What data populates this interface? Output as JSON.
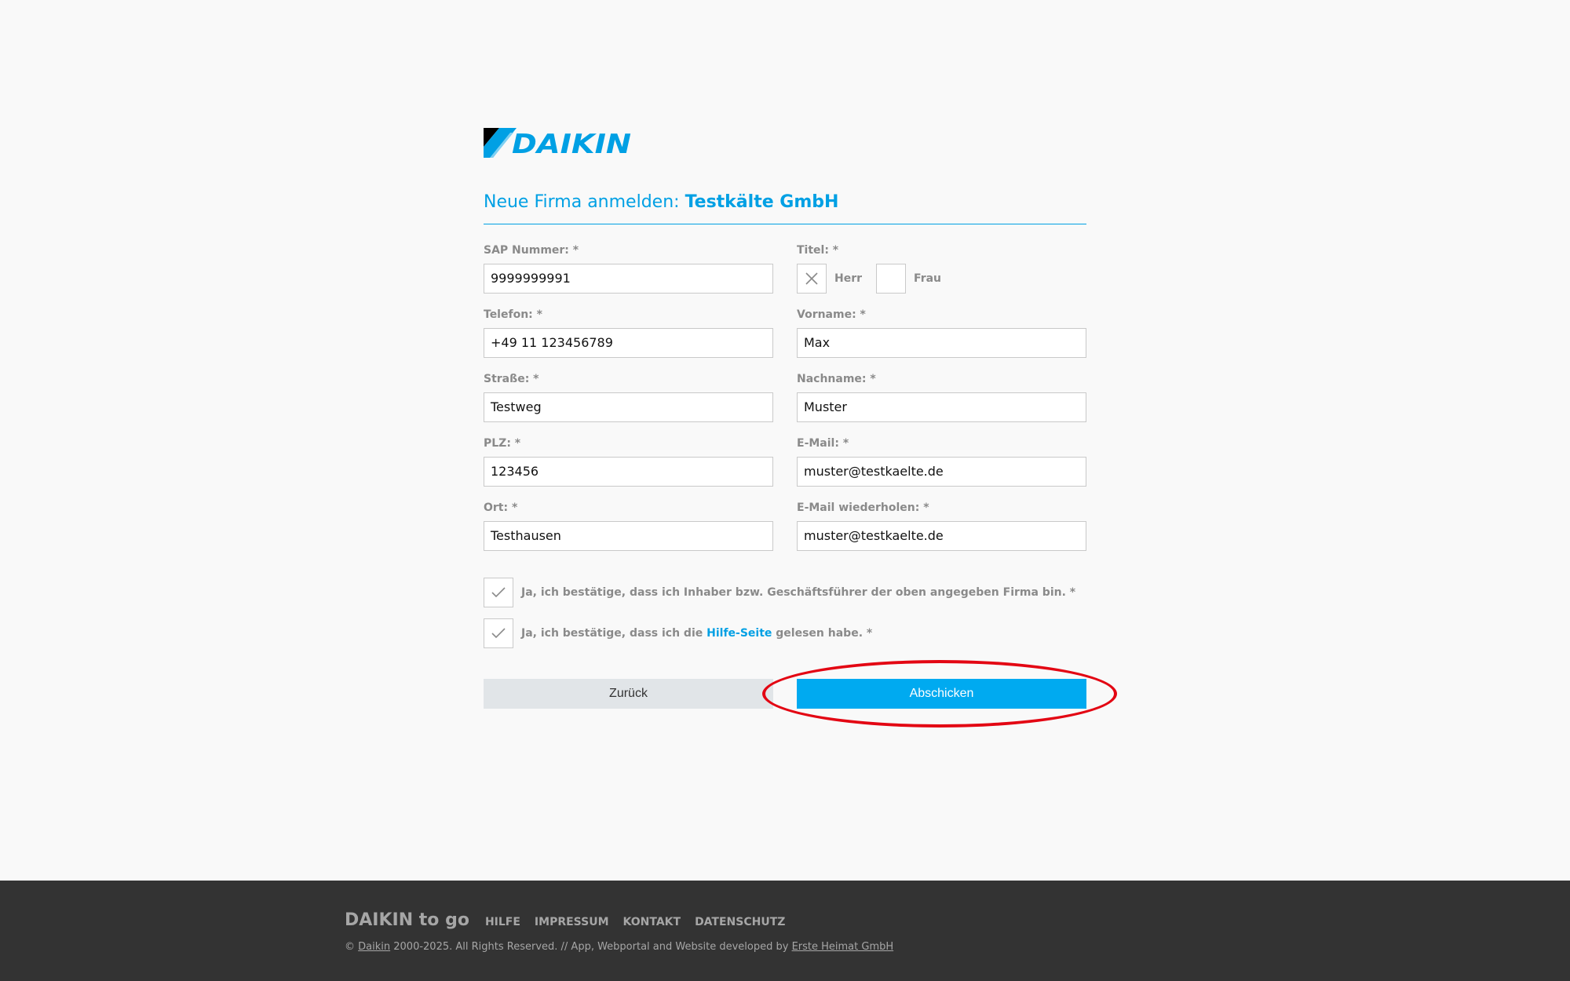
{
  "logo": {
    "text": "DAIKIN",
    "brand_color": "#00a0e4"
  },
  "heading": {
    "prefix": "Neue Firma anmelden:",
    "company": "Testkälte GmbH"
  },
  "form": {
    "sap": {
      "label": "SAP Nummer: *",
      "value": "9999999991"
    },
    "titel": {
      "label": "Titel: *",
      "options": [
        "Herr",
        "Frau"
      ],
      "selected": "Herr"
    },
    "telefon": {
      "label": "Telefon: *",
      "value": "+49 11 123456789"
    },
    "vorname": {
      "label": "Vorname: *",
      "value": "Max"
    },
    "strasse": {
      "label": "Straße: *",
      "value": "Testweg"
    },
    "nachname": {
      "label": "Nachname: *",
      "value": "Muster"
    },
    "plz": {
      "label": "PLZ: *",
      "value": "123456"
    },
    "email": {
      "label": "E-Mail: *",
      "value": "muster@testkaelte.de"
    },
    "ort": {
      "label": "Ort: *",
      "value": "Testhausen"
    },
    "email_repeat": {
      "label": "E-Mail wiederholen: *",
      "value": "muster@testkaelte.de"
    }
  },
  "confirm1": {
    "text": "Ja, ich bestätige, dass ich Inhaber bzw. Geschäftsführer der oben angegeben Firma bin. *",
    "checked": true
  },
  "confirm2": {
    "before": "Ja, ich bestätige, dass ich die",
    "link": "Hilfe-Seite",
    "after": "gelesen habe. *",
    "checked": true
  },
  "buttons": {
    "back": "Zurück",
    "submit": "Abschicken"
  },
  "footer": {
    "brand": "DAIKIN to go",
    "links": [
      "HILFE",
      "IMPRESSUM",
      "KONTAKT",
      "DATENSCHUTZ"
    ],
    "copy_prefix": "©",
    "copy_link1": "Daikin",
    "copy_middle": "2000-2025. All Rights Reserved. // App, Webportal and Website developed by",
    "copy_link2": "Erste Heimat GmbH"
  },
  "colors": {
    "accent": "#00a0e4",
    "submit": "#00aaf0",
    "highlight": "#e30613",
    "footer_bg": "#333333"
  }
}
